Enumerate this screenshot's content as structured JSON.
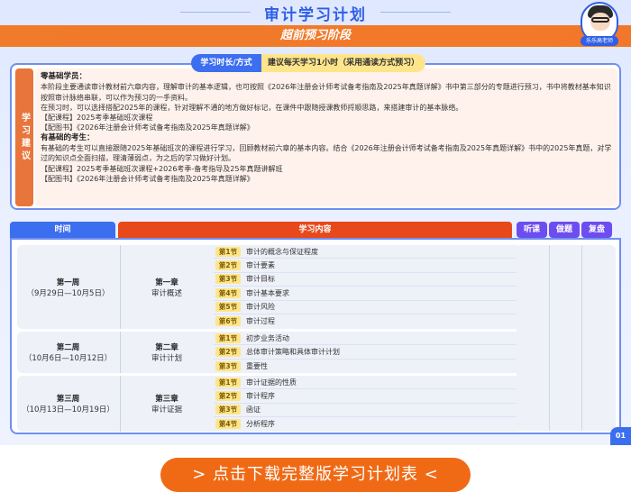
{
  "header": {
    "title": "审计学习计划",
    "stage": "超前预习阶段",
    "avatar_tag": "乐乐高老师"
  },
  "suggestion": {
    "side_label": "学习建议",
    "tab_left": "学习时长/方式",
    "tab_right": "建议每天学习1小时（采用通读方式预习）",
    "zero_title": "零基础学员：",
    "zero_p1": "本阶段主要通读审计教材前六章内容，理解审计的基本逻辑，也可按照《2026年注册会计师考试备考指南及2025年真题详解》书中第三部分的专题进行预习，书中将教材基本知识按照审计脉络串联，可以作为预习的一手资料。",
    "zero_p2": "在预习时，可以选择搭配2025年的课程，针对理解不通的地方做好标记，在课件中跟随授课教师捋顺思路，来搭建审计的基本脉络。",
    "zero_course": "【配课程】2025考季基础班次课程",
    "zero_book": "【配图书】《2026年注册会计师考试备考指南及2025年真题详解》",
    "base_title": "有基础的考生：",
    "base_p1": "有基础的考生可以直接跟随2025年基础班次的课程进行学习，回顾教材前六章的基本内容。结合《2026年注册会计师考试备考指南及2025年真题详解》书中的2025年真题，对学过的知识点全面扫描，理清薄弱点，为之后的学习做好计划。",
    "base_course": "【配课程】2025考季基础班次课程+2026考季-备考指导及25年真题讲解班",
    "base_book": "【配图书】《2026年注册会计师考试备考指南及2025年真题详解》"
  },
  "table": {
    "col_time": "时间",
    "col_content": "学习内容",
    "col_listen": "听课",
    "col_exercise": "做题",
    "col_review": "复盘",
    "weeks": [
      {
        "week": "第一周",
        "dates": "（9月29日—10月5日）",
        "chapter": "第一章",
        "chapter_name": "审计概述",
        "sections": [
          {
            "tag": "第1节",
            "name": "审计的概念与保证程度"
          },
          {
            "tag": "第2节",
            "name": "审计要素"
          },
          {
            "tag": "第3节",
            "name": "审计目标"
          },
          {
            "tag": "第4节",
            "name": "审计基本要求"
          },
          {
            "tag": "第5节",
            "name": "审计风险"
          },
          {
            "tag": "第6节",
            "name": "审计过程"
          }
        ]
      },
      {
        "week": "第二周",
        "dates": "（10月6日—10月12日）",
        "chapter": "第二章",
        "chapter_name": "审计计划",
        "sections": [
          {
            "tag": "第1节",
            "name": "初步业务活动"
          },
          {
            "tag": "第2节",
            "name": "总体审计策略和具体审计计划"
          },
          {
            "tag": "第3节",
            "name": "重要性"
          }
        ]
      },
      {
        "week": "第三周",
        "dates": "（10月13日—10月19日）",
        "chapter": "第三章",
        "chapter_name": "审计证据",
        "sections": [
          {
            "tag": "第1节",
            "name": "审计证据的性质"
          },
          {
            "tag": "第2节",
            "name": "审计程序"
          },
          {
            "tag": "第3节",
            "name": "函证"
          },
          {
            "tag": "第4节",
            "name": "分析程序"
          }
        ]
      }
    ]
  },
  "page_number": "01",
  "download_button": "> 点击下载完整版学习计划表 <",
  "colors": {
    "brand_blue": "#3c6ef0",
    "accent_orange": "#f06a16",
    "content_red": "#e8491b",
    "tag_yellow": "#ffe58a"
  }
}
